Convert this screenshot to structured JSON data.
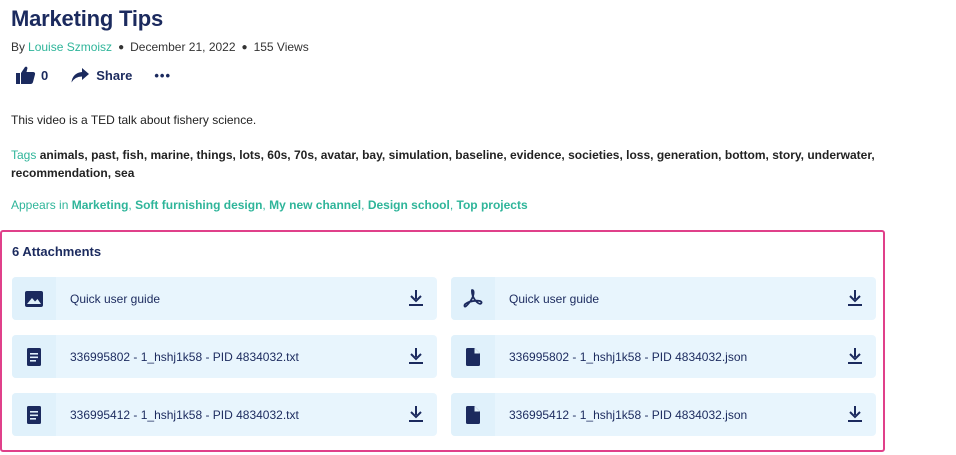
{
  "video": {
    "title": "Marketing Tips",
    "by_label": "By",
    "author": "Louise Szmoisz",
    "date": "December 21, 2022",
    "views": "155 Views",
    "likes": "0",
    "share_label": "Share",
    "more_label": "•••",
    "description": "This video is a TED talk about fishery science."
  },
  "tags": {
    "label": "Tags",
    "items": [
      "animals",
      "past",
      "fish",
      "marine",
      "things",
      "lots",
      "60s",
      "70s",
      "avatar",
      "bay",
      "simulation",
      "baseline",
      "evidence",
      "societies",
      "loss",
      "generation",
      "bottom",
      "story",
      "underwater",
      "recommendation",
      "sea"
    ]
  },
  "appears": {
    "label": "Appears in",
    "channels": [
      "Marketing",
      "Soft furnishing design",
      "My new channel",
      "Design school",
      "Top projects"
    ]
  },
  "attachments": {
    "title": "6 Attachments",
    "items": [
      {
        "name": "Quick user guide",
        "icon": "image-icon"
      },
      {
        "name": "Quick user guide",
        "icon": "pdf-icon"
      },
      {
        "name": "336995802 - 1_hshj1k58 - PID 4834032.txt",
        "icon": "text-file-icon"
      },
      {
        "name": "336995802 - 1_hshj1k58 - PID 4834032.json",
        "icon": "file-icon"
      },
      {
        "name": "336995412 - 1_hshj1k58 - PID 4834032.txt",
        "icon": "text-file-icon"
      },
      {
        "name": "336995412 - 1_hshj1k58 - PID 4834032.json",
        "icon": "file-icon"
      }
    ]
  },
  "colors": {
    "accent": "#2fb59a",
    "title": "#1b2a5e",
    "panel_border": "#e0408a",
    "attachment_bg": "#e8f5fd"
  }
}
